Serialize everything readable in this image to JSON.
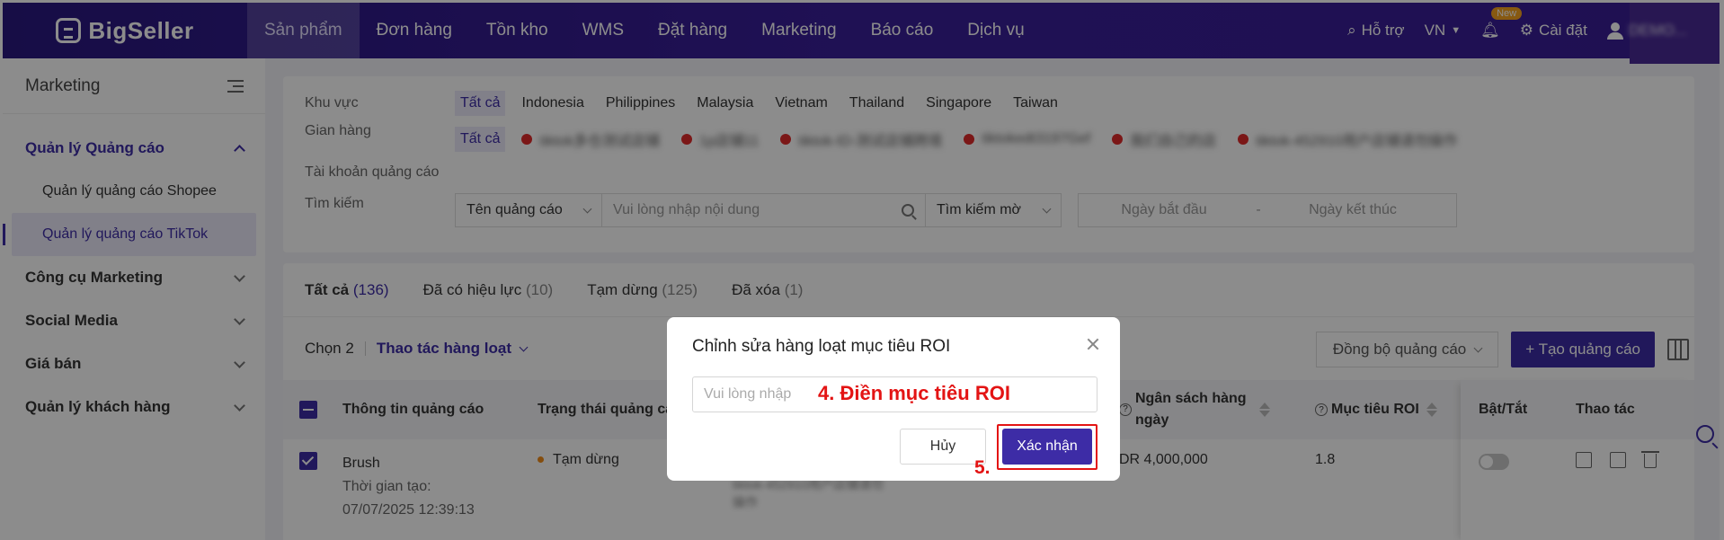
{
  "brand": {
    "name": "BigSeller"
  },
  "topnav": {
    "items": [
      {
        "label": "Sản phẩm",
        "active": true
      },
      {
        "label": "Đơn hàng"
      },
      {
        "label": "Tồn kho"
      },
      {
        "label": "WMS"
      },
      {
        "label": "Đặt hàng"
      },
      {
        "label": "Marketing"
      },
      {
        "label": "Báo cáo"
      },
      {
        "label": "Dịch vụ"
      }
    ],
    "support": "Hỗ trợ",
    "language": "VN",
    "new_badge": "New",
    "settings": "Cài đặt",
    "user": "DEMO..."
  },
  "sidebar": {
    "title": "Marketing",
    "sections": [
      {
        "label": "Quản lý Quảng cáo",
        "open": true
      },
      {
        "label": "Công cụ Marketing"
      },
      {
        "label": "Social Media"
      },
      {
        "label": "Giá bán"
      },
      {
        "label": "Quản lý khách hàng"
      }
    ],
    "sub_items": [
      {
        "label": "Quản lý quảng cáo Shopee"
      },
      {
        "label": "Quản lý quảng cáo TikTok",
        "active": true
      }
    ]
  },
  "filters": {
    "region_label": "Khu vực",
    "regions": [
      "Tất cả",
      "Indonesia",
      "Philippines",
      "Malaysia",
      "Vietnam",
      "Thailand",
      "Singapore",
      "Taiwan"
    ],
    "shop_label": "Gian hàng",
    "shop_all": "Tất cả",
    "shops": [
      "tiktok多仓测试店铺",
      "1p店铺11",
      "tiktok-ID-测试店铺跨境",
      "tiktokedt3197Gef",
      "我们自己的店",
      "tiktok-452910用户店铺请勿操作"
    ],
    "account_label": "Tài khoản quảng cáo",
    "search_label": "Tìm kiếm",
    "search_field": "Tên quảng cáo",
    "search_placeholder": "Vui lòng nhập nội dung",
    "match_mode": "Tìm kiếm mờ",
    "date_start": "Ngày bắt đầu",
    "date_sep": "-",
    "date_end": "Ngày kết thúc"
  },
  "tabs": [
    {
      "label": "Tất cả",
      "count": "(136)",
      "active": true
    },
    {
      "label": "Đã có hiệu lực",
      "count": "(10)"
    },
    {
      "label": "Tạm dừng",
      "count": "(125)"
    },
    {
      "label": "Đã xóa",
      "count": "(1)"
    }
  ],
  "toolbar": {
    "selected": "Chọn 2",
    "batch": "Thao tác hàng loạt",
    "sync": "Đồng bộ quảng cáo",
    "create": "+ Tạo quảng cáo"
  },
  "table": {
    "columns": {
      "info": "Thông tin quảng cáo",
      "status": "Trạng thái quảng cáo",
      "budget": "Ngân sách hàng ngày",
      "roi": "Mục tiêu ROI",
      "toggle": "Bật/Tắt",
      "actions": "Thao tác"
    },
    "rows": [
      {
        "name": "Brush",
        "created_label": "Thời gian tạo:",
        "created": "07/07/2025 12:39:13",
        "status": "Tạm dừng",
        "shop": "tiktok-452910用户店铺请勿操作",
        "budget": "DR 4,000,000",
        "roi": "1.8"
      }
    ]
  },
  "modal": {
    "title": "Chỉnh sửa hàng loạt mục tiêu ROI",
    "input_placeholder": "Vui lòng nhập",
    "cancel": "Hủy",
    "confirm": "Xác nhận",
    "annotation_step4": "4. Điền mục tiêu ROI",
    "annotation_step5": "5."
  },
  "colors": {
    "nav": "#3a1f9a",
    "accent": "#3d2ca6",
    "annotation": "#e31414",
    "status_paused": "#f08c1a"
  }
}
